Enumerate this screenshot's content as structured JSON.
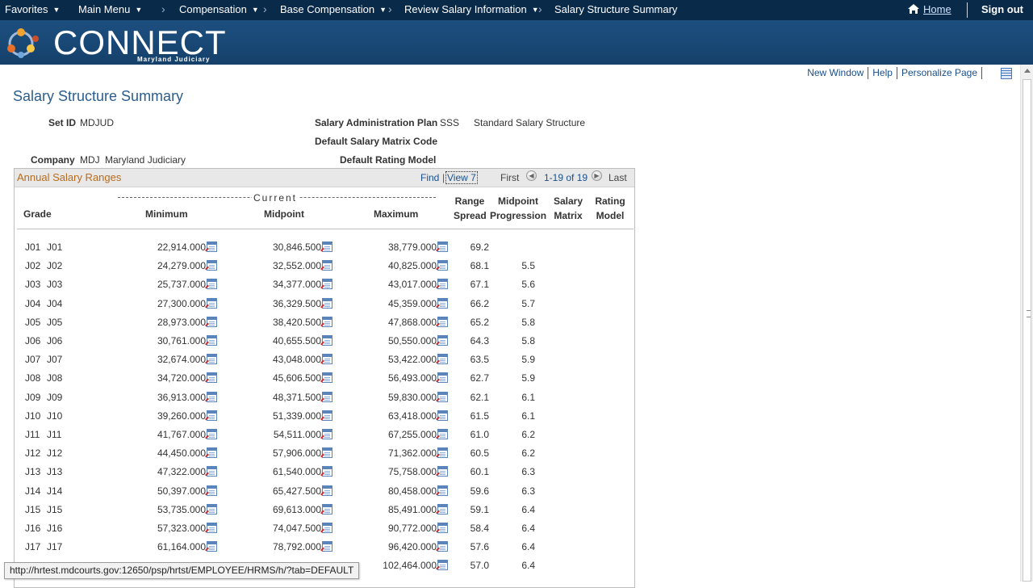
{
  "nav": {
    "favorites": "Favorites",
    "main_menu": "Main Menu",
    "crumbs": [
      "Compensation",
      "Base Compensation",
      "Review Salary Information",
      "Salary Structure Summary"
    ],
    "home": "Home",
    "signout": "Sign out"
  },
  "banner": {
    "logo": "CONNECT",
    "sub": "Maryland Judiciary"
  },
  "util_links": {
    "new_window": "New Window",
    "help": "Help",
    "personalize": "Personalize Page"
  },
  "page": {
    "title": "Salary Structure Summary",
    "setid_label": "Set ID",
    "setid_value": "MDJUD",
    "sal_plan_label": "Salary Administration Plan",
    "sal_plan_code": "SSS",
    "sal_plan_desc": "Standard Salary Structure",
    "matrix_label": "Default Salary Matrix Code",
    "company_label": "Company",
    "company_code": "MDJ",
    "company_name": "Maryland Judiciary",
    "rating_label": "Default Rating Model"
  },
  "grid": {
    "title": "Annual Salary Ranges",
    "find": "Find",
    "view": "View 7",
    "first": "First",
    "range": "1-19 of 19",
    "last": "Last",
    "current_label": "Current",
    "headers": {
      "grade": "Grade",
      "minimum": "Minimum",
      "midpoint": "Midpoint",
      "maximum": "Maximum",
      "range_spread_1": "Range",
      "range_spread_2": "Spread",
      "mid_prog_1": "Midpoint",
      "mid_prog_2": "Progression",
      "sal_matrix_1": "Salary",
      "sal_matrix_2": "Matrix",
      "rating_1": "Rating",
      "rating_2": "Model"
    },
    "rows": [
      {
        "g1": "J01",
        "g2": "J01",
        "min": "22,914.000",
        "mid": "30,846.500",
        "max": "38,779.000",
        "rs": "69.2",
        "mp": ""
      },
      {
        "g1": "J02",
        "g2": "J02",
        "min": "24,279.000",
        "mid": "32,552.000",
        "max": "40,825.000",
        "rs": "68.1",
        "mp": "5.5"
      },
      {
        "g1": "J03",
        "g2": "J03",
        "min": "25,737.000",
        "mid": "34,377.000",
        "max": "43,017.000",
        "rs": "67.1",
        "mp": "5.6"
      },
      {
        "g1": "J04",
        "g2": "J04",
        "min": "27,300.000",
        "mid": "36,329.500",
        "max": "45,359.000",
        "rs": "66.2",
        "mp": "5.7"
      },
      {
        "g1": "J05",
        "g2": "J05",
        "min": "28,973.000",
        "mid": "38,420.500",
        "max": "47,868.000",
        "rs": "65.2",
        "mp": "5.8"
      },
      {
        "g1": "J06",
        "g2": "J06",
        "min": "30,761.000",
        "mid": "40,655.500",
        "max": "50,550.000",
        "rs": "64.3",
        "mp": "5.8"
      },
      {
        "g1": "J07",
        "g2": "J07",
        "min": "32,674.000",
        "mid": "43,048.000",
        "max": "53,422.000",
        "rs": "63.5",
        "mp": "5.9"
      },
      {
        "g1": "J08",
        "g2": "J08",
        "min": "34,720.000",
        "mid": "45,606.500",
        "max": "56,493.000",
        "rs": "62.7",
        "mp": "5.9"
      },
      {
        "g1": "J09",
        "g2": "J09",
        "min": "36,913.000",
        "mid": "48,371.500",
        "max": "59,830.000",
        "rs": "62.1",
        "mp": "6.1"
      },
      {
        "g1": "J10",
        "g2": "J10",
        "min": "39,260.000",
        "mid": "51,339.000",
        "max": "63,418.000",
        "rs": "61.5",
        "mp": "6.1"
      },
      {
        "g1": "J11",
        "g2": "J11",
        "min": "41,767.000",
        "mid": "54,511.000",
        "max": "67,255.000",
        "rs": "61.0",
        "mp": "6.2"
      },
      {
        "g1": "J12",
        "g2": "J12",
        "min": "44,450.000",
        "mid": "57,906.000",
        "max": "71,362.000",
        "rs": "60.5",
        "mp": "6.2"
      },
      {
        "g1": "J13",
        "g2": "J13",
        "min": "47,322.000",
        "mid": "61,540.000",
        "max": "75,758.000",
        "rs": "60.1",
        "mp": "6.3"
      },
      {
        "g1": "J14",
        "g2": "J14",
        "min": "50,397.000",
        "mid": "65,427.500",
        "max": "80,458.000",
        "rs": "59.6",
        "mp": "6.3"
      },
      {
        "g1": "J15",
        "g2": "J15",
        "min": "53,735.000",
        "mid": "69,613.000",
        "max": "85,491.000",
        "rs": "59.1",
        "mp": "6.4"
      },
      {
        "g1": "J16",
        "g2": "J16",
        "min": "57,323.000",
        "mid": "74,047.500",
        "max": "90,772.000",
        "rs": "58.4",
        "mp": "6.4"
      },
      {
        "g1": "J17",
        "g2": "J17",
        "min": "61,164.000",
        "mid": "78,792.000",
        "max": "96,420.000",
        "rs": "57.6",
        "mp": "6.4"
      },
      {
        "g1": "",
        "g2": "",
        "min": "",
        "mid": "",
        "max": "102,464.000",
        "rs": "57.0",
        "mp": "6.4"
      }
    ]
  },
  "statusbar": "http://hrtest.mdcourts.gov:12650/psp/hrtst/EMPLOYEE/HRMS/h/?tab=DEFAULT"
}
